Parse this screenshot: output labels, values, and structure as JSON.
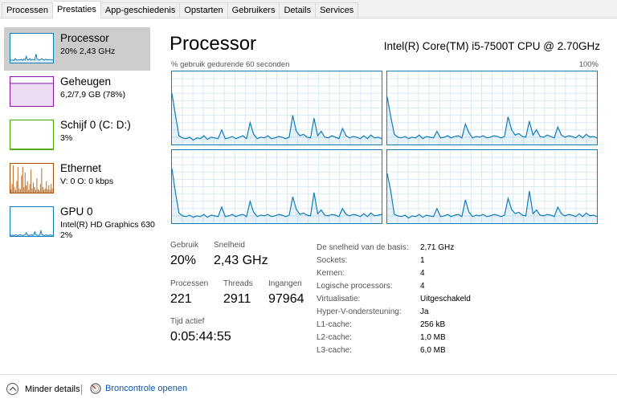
{
  "tabs": [
    {
      "label": "Processen",
      "active": false
    },
    {
      "label": "Prestaties",
      "active": true
    },
    {
      "label": "App-geschiedenis",
      "active": false
    },
    {
      "label": "Opstarten",
      "active": false
    },
    {
      "label": "Gebruikers",
      "active": false
    },
    {
      "label": "Details",
      "active": false
    },
    {
      "label": "Services",
      "active": false
    }
  ],
  "sidebar": {
    "items": [
      {
        "title": "Processor",
        "sub": "20% 2,43 GHz",
        "sub2": "",
        "color": "#117dbb",
        "selected": true
      },
      {
        "title": "Geheugen",
        "sub": "6,2/7,9 GB (78%)",
        "sub2": "",
        "color": "#8b12ae",
        "selected": false
      },
      {
        "title": "Schijf 0 (C: D:)",
        "sub": "3%",
        "sub2": "",
        "color": "#4da60c",
        "selected": false
      },
      {
        "title": "Ethernet",
        "sub": "V: 0 O: 0 kbps",
        "sub2": "",
        "color": "#a74f01",
        "selected": false
      },
      {
        "title": "GPU 0",
        "sub": "Intel(R) HD Graphics 630",
        "sub2": "2%",
        "color": "#117dbb",
        "selected": false
      }
    ]
  },
  "main": {
    "title": "Processor",
    "cpu_name": "Intel(R) Core(TM) i5-7500T CPU @ 2.70GHz",
    "graph_caption": "% gebruik gedurende 60 seconden",
    "graph_max": "100%",
    "graph_color": "#117dbb",
    "stats": {
      "usage_label": "Gebruik",
      "usage_value": "20%",
      "speed_label": "Snelheid",
      "speed_value": "2,43 GHz",
      "processes_label": "Processen",
      "processes_value": "221",
      "threads_label": "Threads",
      "threads_value": "2911",
      "handles_label": "Ingangen",
      "handles_value": "97964",
      "uptime_label": "Tijd actief",
      "uptime_value": "0:05:44:55"
    },
    "properties": [
      {
        "label": "De snelheid van de basis:",
        "value": "2,71 GHz"
      },
      {
        "label": "Sockets:",
        "value": "1"
      },
      {
        "label": "Kernen:",
        "value": "4"
      },
      {
        "label": "Logische processors:",
        "value": "4"
      },
      {
        "label": "Virtualisatie:",
        "value": "Uitgeschakeld"
      },
      {
        "label": "Hyper-V-ondersteuning:",
        "value": "Ja"
      },
      {
        "label": "L1-cache:",
        "value": "256 kB"
      },
      {
        "label": "L2-cache:",
        "value": "1,0 MB"
      },
      {
        "label": "L3-cache:",
        "value": "6,0 MB"
      }
    ]
  },
  "footer": {
    "fewer_details": "Minder details",
    "open_resmon": "Broncontrole openen",
    "link_color": "#0a55b4"
  },
  "chart_data": {
    "type": "line",
    "series": [
      {
        "values": [
          70,
          40,
          12,
          9,
          8,
          10,
          6,
          9,
          8,
          12,
          7,
          10,
          9,
          8,
          20,
          8,
          9,
          11,
          8,
          10,
          12,
          8,
          30,
          14,
          8,
          10,
          9,
          12,
          8,
          9,
          11,
          10,
          8,
          10,
          40,
          18,
          12,
          14,
          10,
          9,
          36,
          12,
          18,
          10,
          9,
          12,
          10,
          8,
          22,
          12,
          9,
          11,
          10,
          8,
          12,
          8,
          13,
          9,
          10,
          8
        ]
      },
      {
        "values": [
          65,
          38,
          14,
          10,
          9,
          11,
          8,
          10,
          9,
          13,
          8,
          11,
          10,
          9,
          18,
          9,
          10,
          12,
          9,
          11,
          12,
          9,
          28,
          16,
          9,
          11,
          10,
          12,
          9,
          10,
          12,
          11,
          9,
          11,
          38,
          20,
          13,
          15,
          11,
          10,
          32,
          13,
          20,
          11,
          10,
          13,
          11,
          9,
          24,
          13,
          10,
          12,
          11,
          9,
          13,
          9,
          14,
          10,
          11,
          9
        ]
      },
      {
        "values": [
          75,
          42,
          14,
          10,
          9,
          11,
          8,
          10,
          9,
          12,
          8,
          11,
          10,
          9,
          22,
          9,
          10,
          12,
          9,
          11,
          12,
          9,
          30,
          15,
          9,
          11,
          10,
          12,
          9,
          10,
          12,
          11,
          9,
          11,
          36,
          19,
          12,
          14,
          11,
          10,
          42,
          13,
          18,
          11,
          10,
          12,
          11,
          9,
          20,
          12,
          10,
          12,
          11,
          9,
          13,
          9,
          14,
          10,
          11,
          12
        ]
      },
      {
        "values": [
          68,
          44,
          12,
          10,
          9,
          11,
          7,
          10,
          9,
          12,
          8,
          11,
          10,
          9,
          20,
          9,
          10,
          12,
          9,
          11,
          12,
          9,
          32,
          15,
          9,
          11,
          10,
          12,
          9,
          10,
          12,
          11,
          9,
          11,
          34,
          19,
          13,
          15,
          11,
          10,
          44,
          13,
          18,
          11,
          10,
          12,
          11,
          9,
          22,
          13,
          10,
          12,
          11,
          9,
          13,
          9,
          14,
          10,
          11,
          9
        ]
      }
    ],
    "ylim": [
      0,
      100
    ],
    "grid": true,
    "sidebar_thumbs": [
      {
        "kind": "line",
        "values": [
          10,
          8,
          9,
          7,
          14,
          9,
          8,
          10,
          9,
          11,
          8,
          12,
          9,
          22,
          10,
          9,
          14,
          9,
          11,
          10,
          9,
          30,
          12,
          10,
          9,
          11,
          14,
          10,
          9,
          12,
          10,
          9,
          11,
          10,
          9,
          10
        ]
      },
      {
        "kind": "fill",
        "values": [
          78,
          78,
          78,
          78,
          78,
          78,
          78,
          78,
          78,
          78,
          78,
          78,
          78,
          78,
          78,
          78,
          78,
          78,
          78,
          78,
          78,
          78,
          78,
          78,
          78,
          78,
          78,
          78,
          78,
          78,
          78,
          78,
          78,
          78,
          78,
          78
        ]
      },
      {
        "kind": "line",
        "values": [
          1,
          1,
          1,
          1,
          1,
          1,
          1,
          1,
          1,
          1,
          1,
          1,
          1,
          1,
          1,
          1,
          1,
          1,
          1,
          1,
          1,
          1,
          1,
          1,
          1,
          1,
          1,
          1,
          1,
          1,
          1,
          1,
          1,
          1,
          1,
          1
        ]
      },
      {
        "kind": "bars",
        "values": [
          12,
          30,
          95,
          20,
          10,
          40,
          88,
          15,
          12,
          60,
          90,
          20,
          70,
          25,
          40,
          10,
          30,
          80,
          15,
          35,
          20,
          10,
          50,
          12,
          8,
          30,
          85,
          20,
          10,
          15,
          40,
          12,
          25,
          10,
          30,
          15
        ]
      },
      {
        "kind": "line",
        "values": [
          3,
          2,
          3,
          2,
          4,
          3,
          2,
          3,
          5,
          3,
          2,
          3,
          4,
          12,
          3,
          2,
          3,
          4,
          3,
          2,
          15,
          4,
          3,
          2,
          3,
          18,
          4,
          3,
          2,
          4,
          3,
          2,
          3,
          4,
          2,
          3
        ]
      }
    ]
  }
}
